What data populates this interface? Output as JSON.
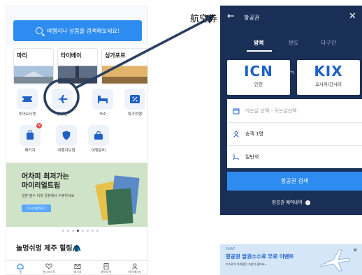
{
  "left": {
    "search_placeholder": "여행지나 상품을 검색해보세요!",
    "cities": [
      "파리",
      "타이베이",
      "싱가포르"
    ],
    "categories": [
      {
        "label": "투어&티켓",
        "icon": "ticket-icon"
      },
      {
        "label": "항공권",
        "icon": "airplane-icon"
      },
      {
        "label": "숙소",
        "icon": "bed-icon"
      },
      {
        "label": "특가여행",
        "icon": "discount-icon"
      },
      {
        "label": "패키지",
        "icon": "suitcase-icon",
        "badge": "N"
      },
      {
        "label": "여행자보험",
        "icon": "shield-icon"
      },
      {
        "label": "여행준비",
        "icon": "bag-icon"
      }
    ],
    "banner": {
      "title_line1": "어차피 최저가는",
      "title_line2": "마이리얼트립",
      "subtitle": "일본 필수 티켓 공항에서 수령하세요",
      "button": "즉시 예약하기"
    },
    "section_title": "놀멍쉬멍 제주 힐링🧥",
    "bottom_nav": [
      "홈",
      "위시리스트",
      "메시지",
      "예약내역",
      "마이페이지"
    ]
  },
  "connector_label": "航空券",
  "right": {
    "title": "항공권",
    "back_icon": "back-arrow-icon",
    "close_icon": "close-icon",
    "tabs": [
      "왕복",
      "편도",
      "다구간"
    ],
    "active_tab": "왕복",
    "origin": {
      "code": "ICN",
      "name": "인천"
    },
    "destination": {
      "code": "KIX",
      "name": "오사카/간사이"
    },
    "date_placeholder": "가는날 선택 - 오는날선택",
    "passengers": "승객 1명",
    "seat_class": "일반석",
    "search_button": "항공권 검색",
    "history_link": "항공권 예약내역",
    "promo": {
      "eyebrow": "EVENT",
      "title": "항공권 발권수수료 무료 이벤트",
      "subtitle": "수수료가 아까웠던 기분이 좋아요~"
    }
  },
  "colors": {
    "accent": "#2e8cf0",
    "navy": "#1a2f55",
    "airport_code": "#1e61c8"
  }
}
